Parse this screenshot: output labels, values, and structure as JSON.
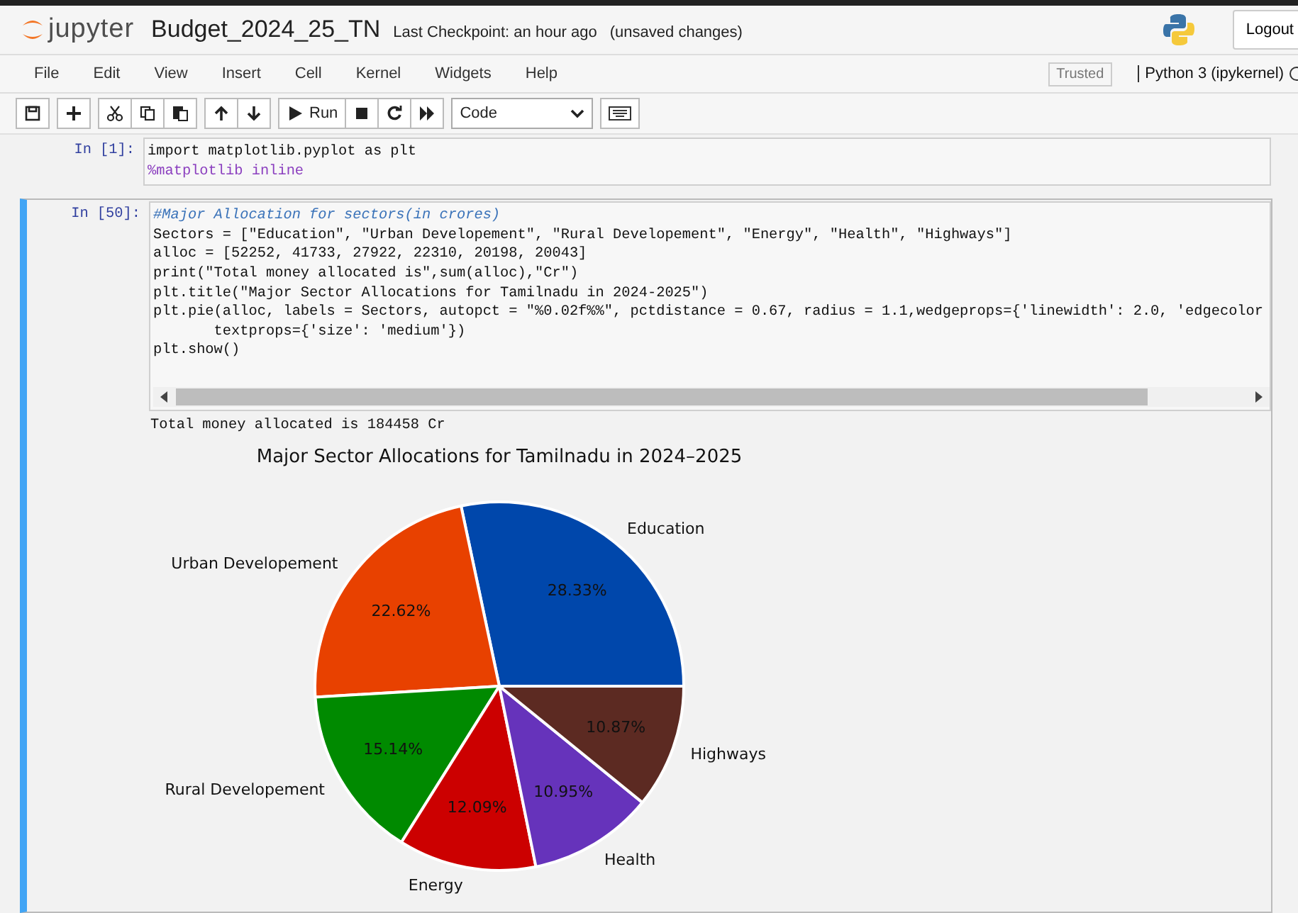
{
  "header": {
    "logo_text": "jupyter",
    "notebook_name": "Budget_2024_25_TN",
    "checkpoint": "Last Checkpoint: an hour ago",
    "save_status": "(unsaved changes)",
    "logout": "Logout"
  },
  "menu": {
    "items": [
      "File",
      "Edit",
      "View",
      "Insert",
      "Cell",
      "Kernel",
      "Widgets",
      "Help"
    ],
    "trusted": "Trusted",
    "kernel": "Python 3 (ipykernel)"
  },
  "toolbar": {
    "buttons": [
      {
        "kind": "save"
      },
      {
        "kind": "add"
      },
      {
        "kind": "cut"
      },
      {
        "kind": "copy"
      },
      {
        "kind": "paste"
      },
      {
        "kind": "up"
      },
      {
        "kind": "down"
      },
      {
        "kind": "run",
        "label": "Run"
      },
      {
        "kind": "stop"
      },
      {
        "kind": "restart"
      },
      {
        "kind": "fast-forward"
      }
    ],
    "cell_type": "Code"
  },
  "cells": [
    {
      "prompt": "In [1]:",
      "selected": false,
      "lines": [
        {
          "kind": "code",
          "text": "import matplotlib.pyplot as plt"
        },
        {
          "kind": "magic",
          "text": "%matplotlib inline"
        }
      ]
    },
    {
      "prompt": "In [50]:",
      "selected": true,
      "scrollbar": true,
      "lines": [
        {
          "kind": "comment",
          "text": "#Major Allocation for sectors(in crores)"
        },
        {
          "kind": "code",
          "text": "Sectors = [\"Education\", \"Urban Developement\", \"Rural Developement\", \"Energy\", \"Health\", \"Highways\"]"
        },
        {
          "kind": "code",
          "text": "alloc = [52252, 41733, 27922, 22310, 20198, 20043]"
        },
        {
          "kind": "code",
          "text": "print(\"Total money allocated is\",sum(alloc),\"Cr\")"
        },
        {
          "kind": "code",
          "text": "plt.title(\"Major Sector Allocations for Tamilnadu in 2024-2025\")"
        },
        {
          "kind": "code",
          "text": "plt.pie(alloc, labels = Sectors, autopct = \"%0.02f%%\", pctdistance = 0.67, radius = 1.1,wedgeprops={'linewidth': 2.0, 'edgecolor"
        },
        {
          "kind": "code",
          "text": "       textprops={'size': 'medium'})"
        },
        {
          "kind": "code",
          "text": "plt.show()"
        }
      ],
      "output": {
        "text": "Total money allocated is 184458 Cr",
        "chart_data": {
          "type": "pie",
          "title": "Major Sector Allocations for Tamilnadu in 2024–2025",
          "categories": [
            "Education",
            "Urban Developement",
            "Rural Developement",
            "Energy",
            "Health",
            "Highways"
          ],
          "values": [
            28.33,
            22.62,
            15.14,
            12.09,
            10.95,
            10.87
          ],
          "colors": [
            "#0047ab",
            "#e84100",
            "#008a00",
            "#cc0000",
            "#6633bb",
            "#5c2a22"
          ],
          "value_labels": [
            "28.33%",
            "22.62%",
            "15.14%",
            "12.09%",
            "10.95%",
            "10.87%"
          ]
        }
      }
    }
  ]
}
